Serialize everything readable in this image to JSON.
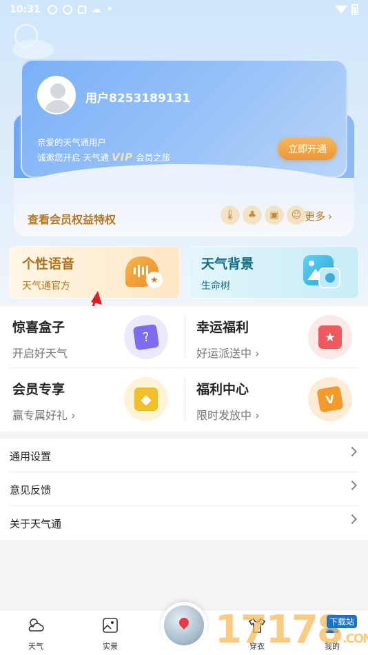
{
  "status_bar": {
    "time": "10:31"
  },
  "member_card": {
    "username": "用户8253189131",
    "greeting_line1": "亲爱的天气通用户",
    "greeting_line2_prefix": "诚邀您开启 天气通",
    "vip_text": "VIP",
    "greeting_line2_suffix": "会员之旅",
    "open_button": "立即开通",
    "benefits_title": "查看会员权益特权",
    "more_label": "更多",
    "benefit_icons": [
      "thermometer-icon",
      "tree-icon",
      "frame-icon",
      "smile-icon"
    ]
  },
  "features": [
    {
      "title": "个性语音",
      "subtitle": "天气通官方",
      "icon": "voice-icon"
    },
    {
      "title": "天气背景",
      "subtitle": "生命树",
      "icon": "image-icon"
    }
  ],
  "grid": [
    {
      "title": "惊喜盒子",
      "subtitle": "开启好天气",
      "icon": "gift-box-icon",
      "color": "#7b6cf0"
    },
    {
      "title": "幸运福利",
      "subtitle": "好运派送中 ›",
      "icon": "ribbon-star-icon",
      "color": "#ef5a5f"
    },
    {
      "title": "会员专享",
      "subtitle": "赢专属好礼 ›",
      "icon": "diamond-icon",
      "color": "#f3bf28"
    },
    {
      "title": "福利中心",
      "subtitle": "限时发放中 ›",
      "icon": "ticket-icon",
      "color": "#f39a2b"
    }
  ],
  "settings": [
    {
      "label": "通用设置"
    },
    {
      "label": "意见反馈"
    },
    {
      "label": "关于天气通"
    }
  ],
  "bottom_nav": [
    {
      "label": "天气",
      "icon": "weather-icon"
    },
    {
      "label": "实景",
      "icon": "photo-icon"
    },
    {
      "label": "",
      "icon": "map-pin-globe-icon"
    },
    {
      "label": "穿衣",
      "icon": "clothes-icon"
    },
    {
      "label": "我的",
      "icon": "user-icon"
    }
  ],
  "watermark": {
    "text": "17178",
    "suffix": ".COM",
    "badge": "下载站"
  },
  "colors": {
    "accent_orange": "#ef9632",
    "gold_text": "#b9761e",
    "card_blue": "#79b0f7"
  }
}
